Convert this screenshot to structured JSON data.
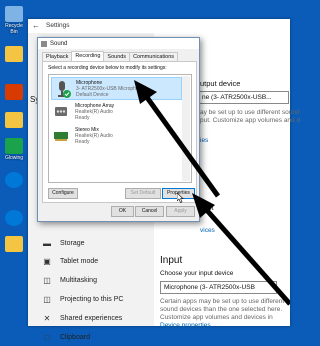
{
  "desktop": {
    "icons": [
      {
        "label": "Recycle Bin",
        "color": "#7fb2e5"
      },
      {
        "label": "",
        "color": "#f4c542"
      },
      {
        "label": "",
        "color": "#d83b01"
      },
      {
        "label": "",
        "color": "#f4c542"
      },
      {
        "label": "Glowing",
        "color": "#1aa34a"
      },
      {
        "label": "",
        "color": "#0078d7"
      },
      {
        "label": "",
        "color": "#0078d7"
      },
      {
        "label": "",
        "color": "#f4c542"
      }
    ]
  },
  "settings": {
    "title": "Settings",
    "sidebar_partial": "Sys",
    "sidebar_items": [
      {
        "label": "Storage",
        "icon": "storage-icon"
      },
      {
        "label": "Tablet mode",
        "icon": "tablet-mode-icon"
      },
      {
        "label": "Multitasking",
        "icon": "multitasking-icon"
      },
      {
        "label": "Projecting to this PC",
        "icon": "projecting-icon"
      },
      {
        "label": "Shared experiences",
        "icon": "shared-experiences-icon"
      },
      {
        "label": "Clipboard",
        "icon": "clipboard-icon"
      }
    ],
    "output": {
      "heading_partial": "utput device",
      "select_value": "ne (3- ATR2500x-USB...",
      "text_partial": "ay be set up to use different sound\nput. Customize app volumes and d",
      "link_partial": "ies",
      "troubleshoot_partial": "hoot",
      "manage_link_partial": "vices"
    },
    "input": {
      "heading": "Input",
      "choose_label": "Choose your input device",
      "select_value": "Microphone (3- ATR2500x-USB",
      "text": "Certain apps may be set up to use different sound devices than the one selected here. Customize app volumes and devices in advanced sound options.",
      "device_properties": "Device properties"
    }
  },
  "sound_dialog": {
    "title": "Sound",
    "tabs": [
      "Playback",
      "Recording",
      "Sounds",
      "Communications"
    ],
    "active_tab": "Recording",
    "instruction": "Select a recording device below to modify its settings:",
    "devices": [
      {
        "name": "Microphone",
        "sub": "3- ATR2500x-USB Microphone",
        "status": "Default Device",
        "selected": true
      },
      {
        "name": "Microphone Array",
        "sub": "Realtek(R) Audio",
        "status": "Ready",
        "selected": false
      },
      {
        "name": "Stereo Mix",
        "sub": "Realtek(R) Audio",
        "status": "Ready",
        "selected": false
      }
    ],
    "buttons": {
      "configure": "Configure",
      "set_default": "Set Default",
      "properties": "Properties",
      "ok": "OK",
      "cancel": "Cancel",
      "apply": "Apply"
    }
  },
  "colors": {
    "accent": "#0078d7",
    "arrow": "#000000",
    "desktop": "#0a5cb8",
    "selected_row": "#cce8ff",
    "default_check": "#1aa34a"
  }
}
